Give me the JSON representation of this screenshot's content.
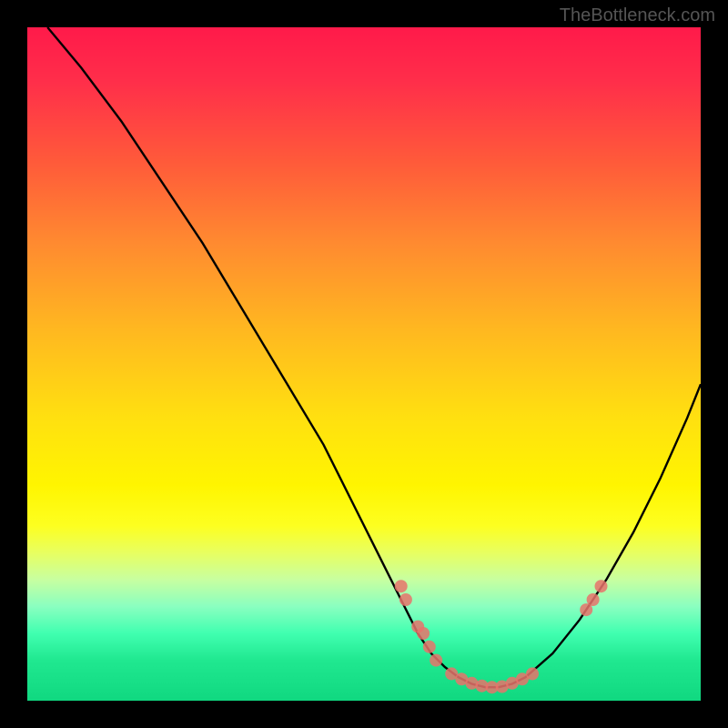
{
  "watermark": "TheBottleneck.com",
  "chart_data": {
    "type": "line",
    "title": "",
    "xlabel": "",
    "ylabel": "",
    "xlim": [
      0,
      100
    ],
    "ylim": [
      0,
      100
    ],
    "curve": {
      "x": [
        3,
        8,
        14,
        20,
        26,
        32,
        38,
        44,
        48,
        52,
        55,
        57,
        58,
        60,
        62,
        64,
        66,
        68,
        70,
        72,
        74,
        78,
        82,
        86,
        90,
        94,
        98,
        100
      ],
      "y": [
        100,
        94,
        86,
        77,
        68,
        58,
        48,
        38,
        30,
        22,
        16,
        12,
        10,
        7,
        5,
        3.5,
        2.5,
        2,
        2,
        2.5,
        3.5,
        7,
        12,
        18,
        25,
        33,
        42,
        47
      ]
    },
    "points": [
      {
        "x": 55.5,
        "y": 17
      },
      {
        "x": 56.2,
        "y": 15
      },
      {
        "x": 58.0,
        "y": 11
      },
      {
        "x": 58.8,
        "y": 10
      },
      {
        "x": 59.7,
        "y": 8
      },
      {
        "x": 60.7,
        "y": 6
      },
      {
        "x": 63.0,
        "y": 4
      },
      {
        "x": 64.5,
        "y": 3.2
      },
      {
        "x": 66.0,
        "y": 2.6
      },
      {
        "x": 67.5,
        "y": 2.2
      },
      {
        "x": 69.0,
        "y": 2
      },
      {
        "x": 70.5,
        "y": 2.1
      },
      {
        "x": 72.0,
        "y": 2.6
      },
      {
        "x": 73.5,
        "y": 3.2
      },
      {
        "x": 75.0,
        "y": 4
      },
      {
        "x": 83.0,
        "y": 13.5
      },
      {
        "x": 84.0,
        "y": 15
      },
      {
        "x": 85.2,
        "y": 17
      }
    ]
  }
}
